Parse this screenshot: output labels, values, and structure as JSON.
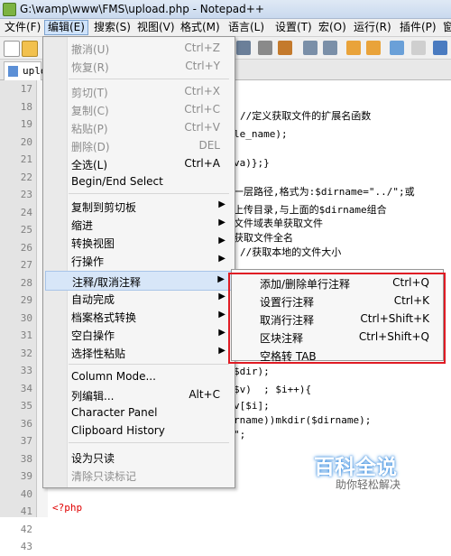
{
  "window": {
    "title": "G:\\wamp\\www\\FMS\\upload.php - Notepad++"
  },
  "menubar": [
    "文件(F)",
    "编辑(E)",
    "搜索(S)",
    "视图(V)",
    "格式(M)",
    "语言(L)",
    "设置(T)",
    "宏(O)",
    "运行(R)",
    "插件(P)",
    "窗"
  ],
  "tab": {
    "label": "uplo"
  },
  "editor": {
    "line_numbers": [
      "17",
      "18",
      "19",
      "20",
      "21",
      "22",
      "23",
      "24",
      "25",
      "26",
      "27",
      "28",
      "29",
      "30",
      "31",
      "32",
      "33",
      "34",
      "35",
      "36",
      "37",
      "38",
      "39",
      "40",
      "41",
      "42",
      "43"
    ],
    "code_fragments": [
      "//定义获取文件的扩展名函数",
      "le_name);",
      "va)};}",
      "一层路径,格式为:$dirname=\"../\";或",
      "上传目录,与上面的$dirname组合",
      "文件域表单获取文件",
      "获取文件全名",
      "//获取本地的文件大小",
      "$dir);",
      "$v)  ; $i++){",
      "v[$i];",
      "rname))mkdir($dirname);",
      "\";",
      "<?php"
    ]
  },
  "edit_menu": {
    "items": [
      {
        "label": "撤消(U)",
        "shortcut": "Ctrl+Z",
        "disabled": true
      },
      {
        "label": "恢复(R)",
        "shortcut": "Ctrl+Y",
        "disabled": true
      },
      {
        "label": "剪切(T)",
        "shortcut": "Ctrl+X",
        "disabled": true
      },
      {
        "label": "复制(C)",
        "shortcut": "Ctrl+C",
        "disabled": true
      },
      {
        "label": "粘贴(P)",
        "shortcut": "Ctrl+V",
        "disabled": true
      },
      {
        "label": "删除(D)",
        "shortcut": "DEL",
        "disabled": true
      },
      {
        "label": "全选(L)",
        "shortcut": "Ctrl+A"
      },
      {
        "label": "Begin/End Select",
        "shortcut": ""
      },
      {
        "label": "复制到剪切板",
        "submenu": true
      },
      {
        "label": "缩进",
        "submenu": true
      },
      {
        "label": "转换视图",
        "submenu": true
      },
      {
        "label": "行操作",
        "submenu": true
      },
      {
        "label": "注释/取消注释",
        "submenu": true,
        "highlighted": true
      },
      {
        "label": "自动完成",
        "submenu": true
      },
      {
        "label": "档案格式转换",
        "submenu": true
      },
      {
        "label": "空白操作",
        "submenu": true
      },
      {
        "label": "选择性粘贴",
        "submenu": true
      },
      {
        "label": "Column Mode..."
      },
      {
        "label": "列编辑...",
        "shortcut": "Alt+C"
      },
      {
        "label": "Character Panel"
      },
      {
        "label": "Clipboard History"
      },
      {
        "label": "设为只读"
      },
      {
        "label": "清除只读标记",
        "disabled": true
      }
    ]
  },
  "comment_submenu": {
    "items": [
      {
        "label": "添加/删除单行注释",
        "shortcut": "Ctrl+Q"
      },
      {
        "label": "设置行注释",
        "shortcut": "Ctrl+K"
      },
      {
        "label": "取消行注释",
        "shortcut": "Ctrl+Shift+K"
      },
      {
        "label": "区块注释",
        "shortcut": "Ctrl+Shift+Q"
      },
      {
        "label": "空格转 TAB",
        "shortcut": ""
      }
    ]
  },
  "watermark": {
    "logo": "百科全说",
    "tagline": "助你轻松解决"
  },
  "colors": {
    "highlight": "#d7e6f8",
    "outline": "#e01b24",
    "disabled_text": "#8d8d8d"
  }
}
